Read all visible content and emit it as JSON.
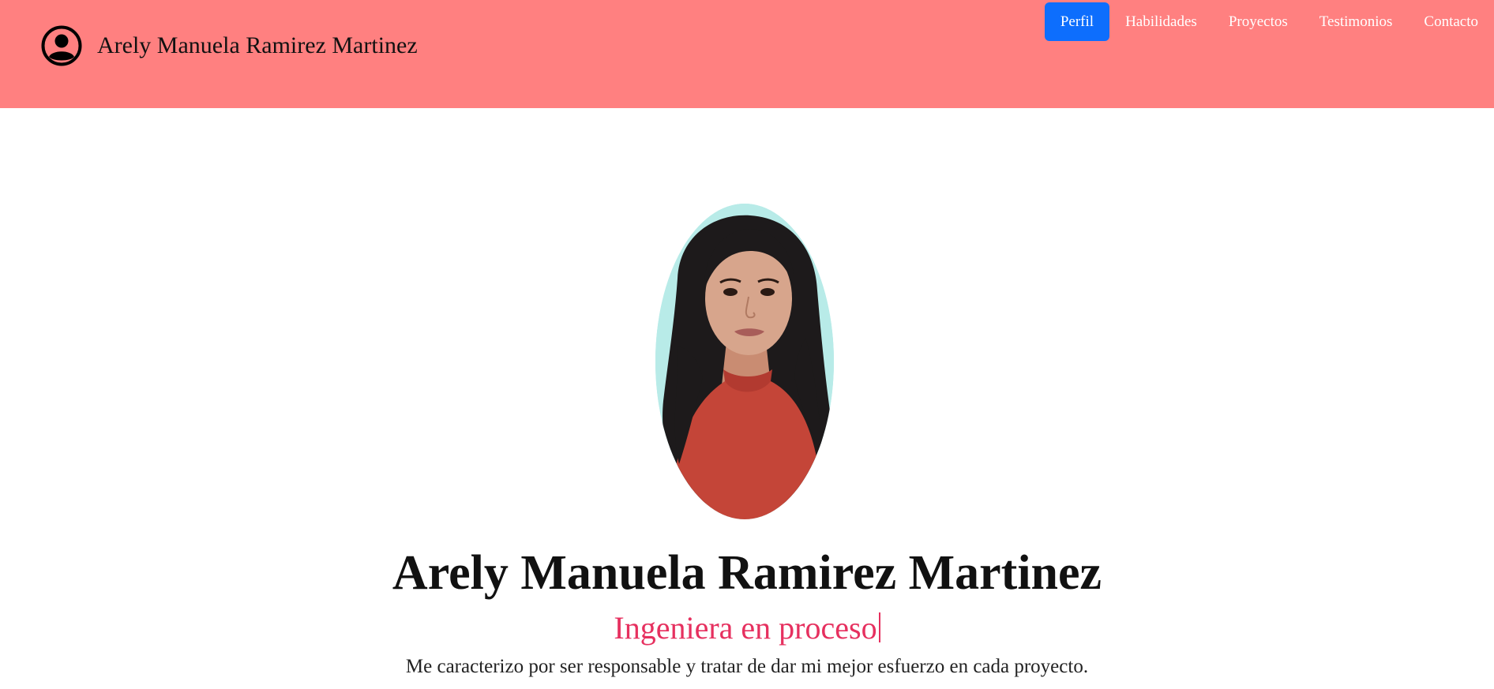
{
  "header": {
    "brand_icon": "user-circle-icon",
    "brand_name": "Arely Manuela Ramirez Martinez",
    "background_color": "#ff8080",
    "nav": [
      {
        "label": "Perfil",
        "active": true
      },
      {
        "label": "Habilidades",
        "active": false
      },
      {
        "label": "Proyectos",
        "active": false
      },
      {
        "label": "Testimonios",
        "active": false
      },
      {
        "label": "Contacto",
        "active": false
      }
    ],
    "active_color": "#0d6efd"
  },
  "hero": {
    "photo": "profile-photo",
    "name": "Arely Manuela Ramirez Martinez",
    "role": "Ingeniera en proceso",
    "role_color": "#e6305f",
    "description": "Me caracterizo por ser responsable y tratar de dar mi mejor esfuerzo en cada proyecto."
  }
}
